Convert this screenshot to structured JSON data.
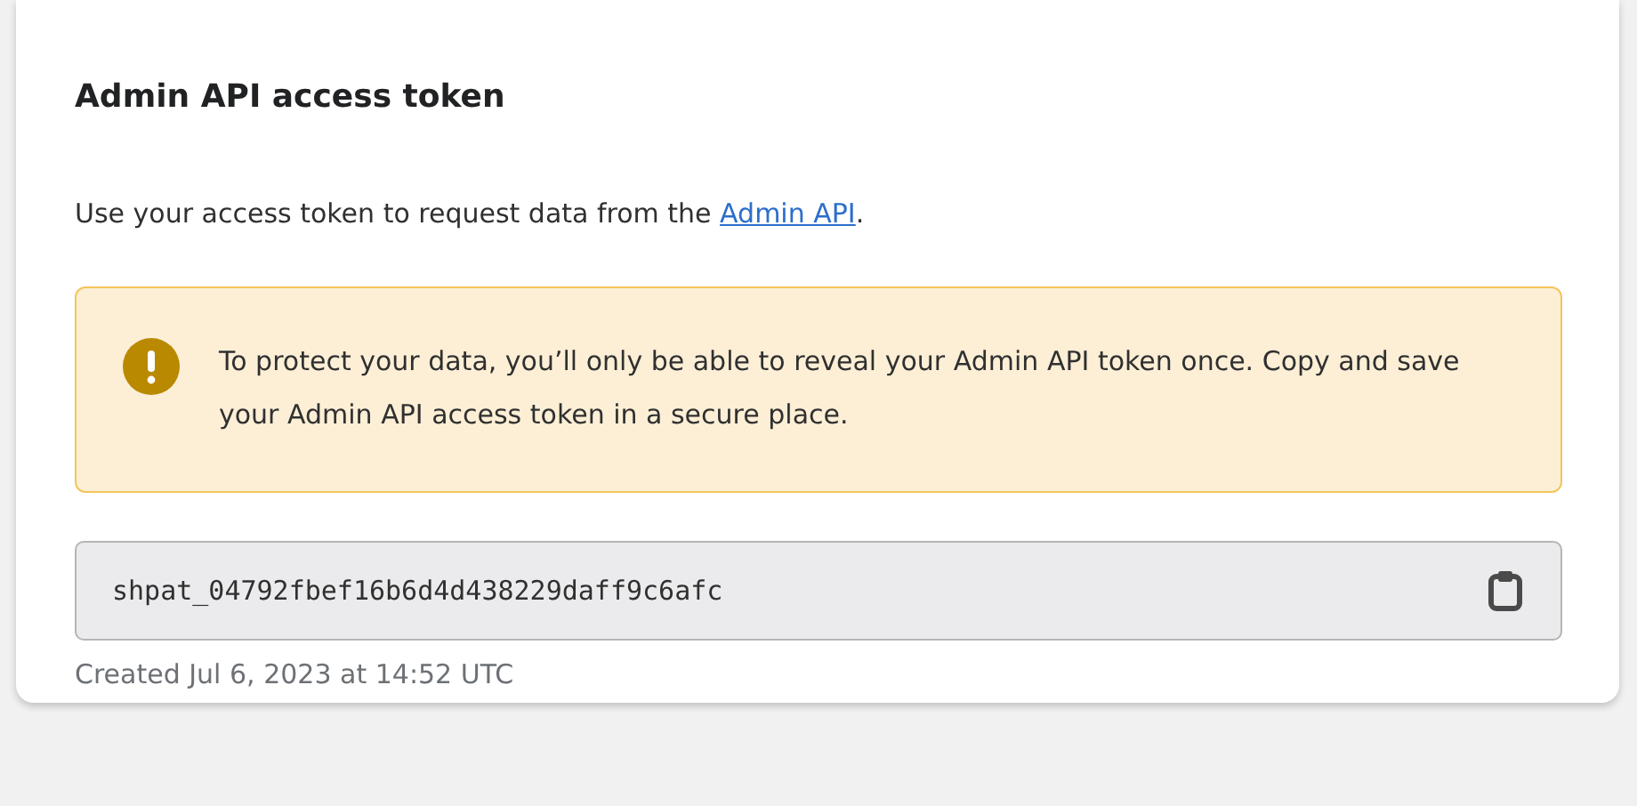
{
  "card": {
    "title": "Admin API access token",
    "description": {
      "before": "Use your access token to request data from the ",
      "link": "Admin API",
      "after": "."
    },
    "banner": {
      "kind": "warning",
      "message": "To protect your data, you’ll only be able to reveal your Admin API token once. Copy and save your Admin API access token in a secure place."
    },
    "token_field": {
      "value": "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"
    },
    "created": "Created Jul 6, 2023 at 14:52 UTC"
  }
}
